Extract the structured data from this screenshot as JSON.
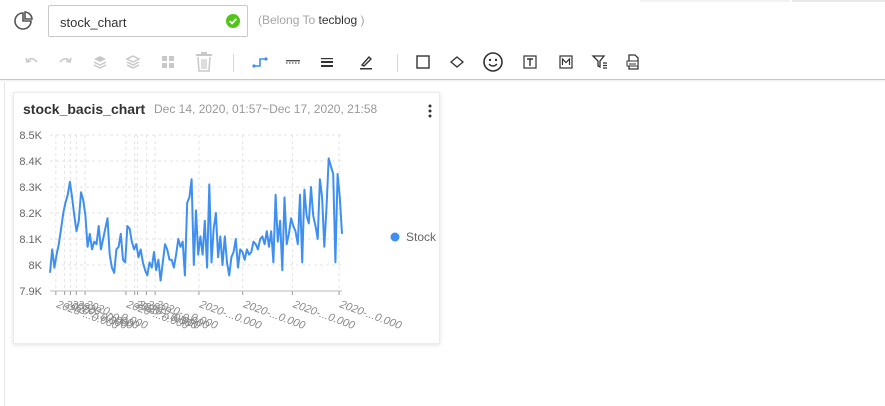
{
  "header": {
    "chart_name": "stock_chart",
    "belong_prefix": "(Belong To ",
    "belong_owner": "tecblog",
    "belong_suffix": " )"
  },
  "toolbar": {
    "items": [
      "undo-icon",
      "redo-icon",
      "layer-up-icon",
      "layer-down-icon",
      "grid-icon",
      "trash-icon",
      "line-style-icon",
      "dashed-line-icon",
      "line-weight-icon",
      "pen-icon",
      "rectangle-icon",
      "diamond-icon",
      "smiley-icon",
      "text-box-icon",
      "markdown-box-icon",
      "filter-icon",
      "page-format-icon"
    ]
  },
  "card": {
    "title": "stock_bacis_chart",
    "range": "Dec 14, 2020, 01:57~Dec 17, 2020, 21:58"
  },
  "chart_data": {
    "type": "line",
    "ylim": [
      7900,
      8500
    ],
    "y_ticks": [
      7900,
      8000,
      8100,
      8200,
      8300,
      8400,
      8500
    ],
    "y_tick_labels": [
      "7.9K",
      "8K",
      "8.1K",
      "8.2K",
      "8.3K",
      "8.4K",
      "8.5K"
    ],
    "x_tick_labels": [
      "2020-...0.000",
      "2020-...0.000",
      "2020-...0.000",
      "2020-...0.000",
      "2020-...0.000",
      "2020-...0.000",
      "2020-...0.000",
      "2020-...0.000",
      "2020-...0.000",
      "2020-...0.000",
      "2020-...0.000",
      "2020-...0.000",
      "2020-...0.000",
      "2020-...0.000"
    ],
    "x_tick_fractions": [
      0.02,
      0.05,
      0.07,
      0.09,
      0.12,
      0.26,
      0.29,
      0.3,
      0.33,
      0.36,
      0.51,
      0.66,
      0.83,
      0.99
    ],
    "legend_position": "right",
    "series": [
      {
        "name": "Stock",
        "color": "#3f8ff0",
        "values": [
          7970,
          8060,
          7990,
          8040,
          8080,
          8140,
          8200,
          8240,
          8270,
          8320,
          8260,
          8190,
          8130,
          8170,
          8280,
          8250,
          8190,
          8070,
          8120,
          8060,
          8090,
          8080,
          8150,
          8060,
          8100,
          8140,
          8180,
          8040,
          7990,
          7970,
          8060,
          8070,
          8120,
          8020,
          8010,
          8150,
          8140,
          8090,
          8060,
          8080,
          8030,
          8060,
          8010,
          7980,
          7960,
          8010,
          7990,
          8050,
          7980,
          8020,
          7940,
          8010,
          8080,
          8060,
          8020,
          8020,
          7990,
          8040,
          8100,
          8070,
          8090,
          7960,
          8240,
          8260,
          8330,
          8000,
          8210,
          8040,
          8110,
          8040,
          8170,
          7990,
          8310,
          8010,
          8140,
          8200,
          8030,
          8110,
          8000,
          8110,
          8010,
          7960,
          8030,
          8050,
          8100,
          7990,
          8060,
          8050,
          8020,
          8060,
          8040,
          8050,
          8090,
          8080,
          8060,
          8100,
          8110,
          8080,
          8130,
          8070,
          8130,
          8010,
          8270,
          8090,
          8170,
          7980,
          8260,
          8080,
          8120,
          8180,
          8150,
          8130,
          8080,
          8270,
          8010,
          8290,
          8190,
          8160,
          8300,
          8190,
          8150,
          8100,
          8330,
          8260,
          8070,
          8220,
          8410,
          8380,
          8350,
          8010,
          8350,
          8260,
          8120
        ]
      }
    ]
  }
}
